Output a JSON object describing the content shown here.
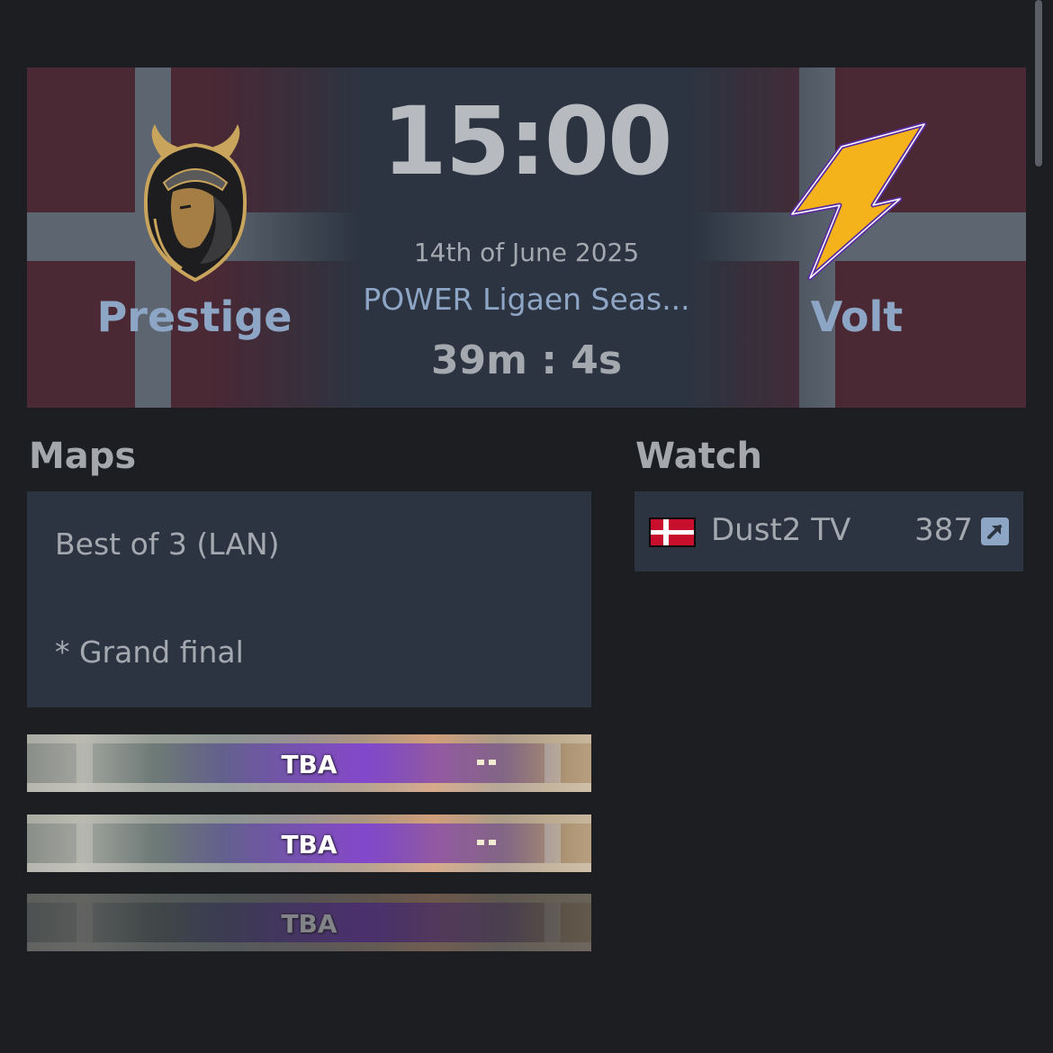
{
  "match": {
    "time": "15:00",
    "date": "14th of June 2025",
    "event": "POWER Ligaen Seas...",
    "countdown": "39m : 4s",
    "team_left": {
      "name": "Prestige",
      "logo_icon": "lion-viking-logo",
      "flag": "denmark"
    },
    "team_right": {
      "name": "Volt",
      "logo_icon": "lightning-bolt-logo",
      "flag": "denmark"
    }
  },
  "maps": {
    "title": "Maps",
    "format": "Best of 3 (LAN)",
    "note": "* Grand final",
    "banners": [
      {
        "label": "TBA"
      },
      {
        "label": "TBA"
      },
      {
        "label": "TBA"
      }
    ]
  },
  "watch": {
    "title": "Watch",
    "streams": [
      {
        "name": "Dust2 TV",
        "viewers": "387",
        "flag": "denmark",
        "icon": "external-link-icon"
      }
    ]
  },
  "colors": {
    "background": "#1c1e22",
    "panel": "#2d3441",
    "accent": "#8ea6c6",
    "text": "#a4a9b0",
    "flag_red": "#4a2834"
  }
}
